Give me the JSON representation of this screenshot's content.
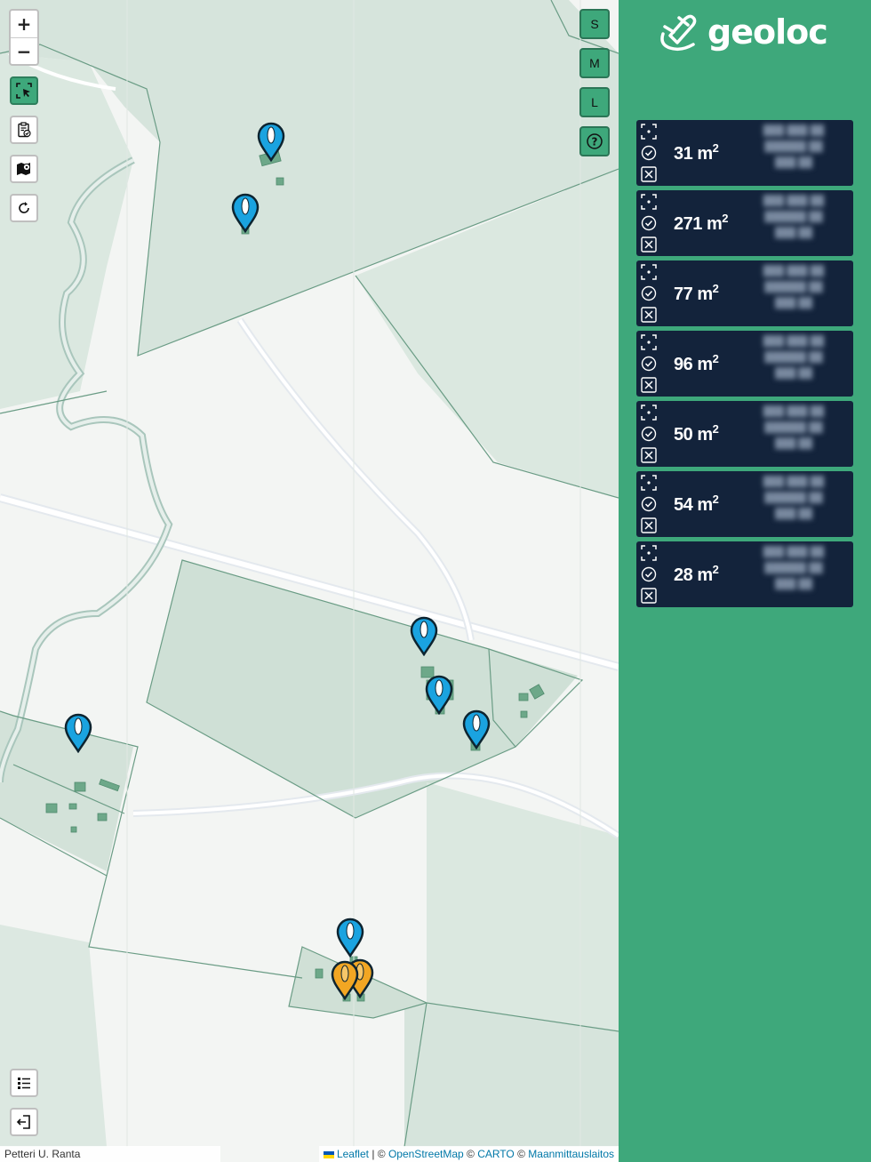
{
  "app": {
    "name": "geoloc"
  },
  "colors": {
    "accent": "#3ea87b",
    "card_bg": "#13233b",
    "pin_blue": "#1aa3e0",
    "pin_orange": "#f2a623"
  },
  "map_controls": {
    "zoom_in": "+",
    "zoom_out": "−",
    "tools": [
      {
        "icon": "select-area-icon",
        "active": true
      },
      {
        "icon": "clipboard-check-icon",
        "active": false
      },
      {
        "icon": "map-pin-icon",
        "active": false
      },
      {
        "icon": "refresh-icon",
        "active": false
      }
    ],
    "bottom_tools": [
      {
        "icon": "list-icon"
      },
      {
        "icon": "logout-icon"
      }
    ]
  },
  "size_buttons": [
    {
      "label": "S"
    },
    {
      "label": "M"
    },
    {
      "label": "L"
    },
    {
      "label": "?",
      "icon": "help-icon"
    }
  ],
  "attribution": {
    "author": "Petteri U. Ranta",
    "leaflet": "Leaflet",
    "sep1": " | © ",
    "osm": "OpenStreetMap",
    "sep2": " © ",
    "carto": "CARTO",
    "sep3": " © ",
    "mml": "Maanmittauslaitos"
  },
  "results": [
    {
      "area_value": "31",
      "area_unit": "m",
      "area_exp": "2"
    },
    {
      "area_value": "271",
      "area_unit": "m",
      "area_exp": "2"
    },
    {
      "area_value": "77",
      "area_unit": "m",
      "area_exp": "2"
    },
    {
      "area_value": "96",
      "area_unit": "m",
      "area_exp": "2"
    },
    {
      "area_value": "50",
      "area_unit": "m",
      "area_exp": "2"
    },
    {
      "area_value": "54",
      "area_unit": "m",
      "area_exp": "2"
    },
    {
      "area_value": "28",
      "area_unit": "m",
      "area_exp": "2"
    }
  ],
  "pins": [
    {
      "color": "blue"
    },
    {
      "color": "blue"
    },
    {
      "color": "blue"
    },
    {
      "color": "blue"
    },
    {
      "color": "blue"
    },
    {
      "color": "blue"
    },
    {
      "color": "blue"
    },
    {
      "color": "orange"
    },
    {
      "color": "orange"
    }
  ]
}
